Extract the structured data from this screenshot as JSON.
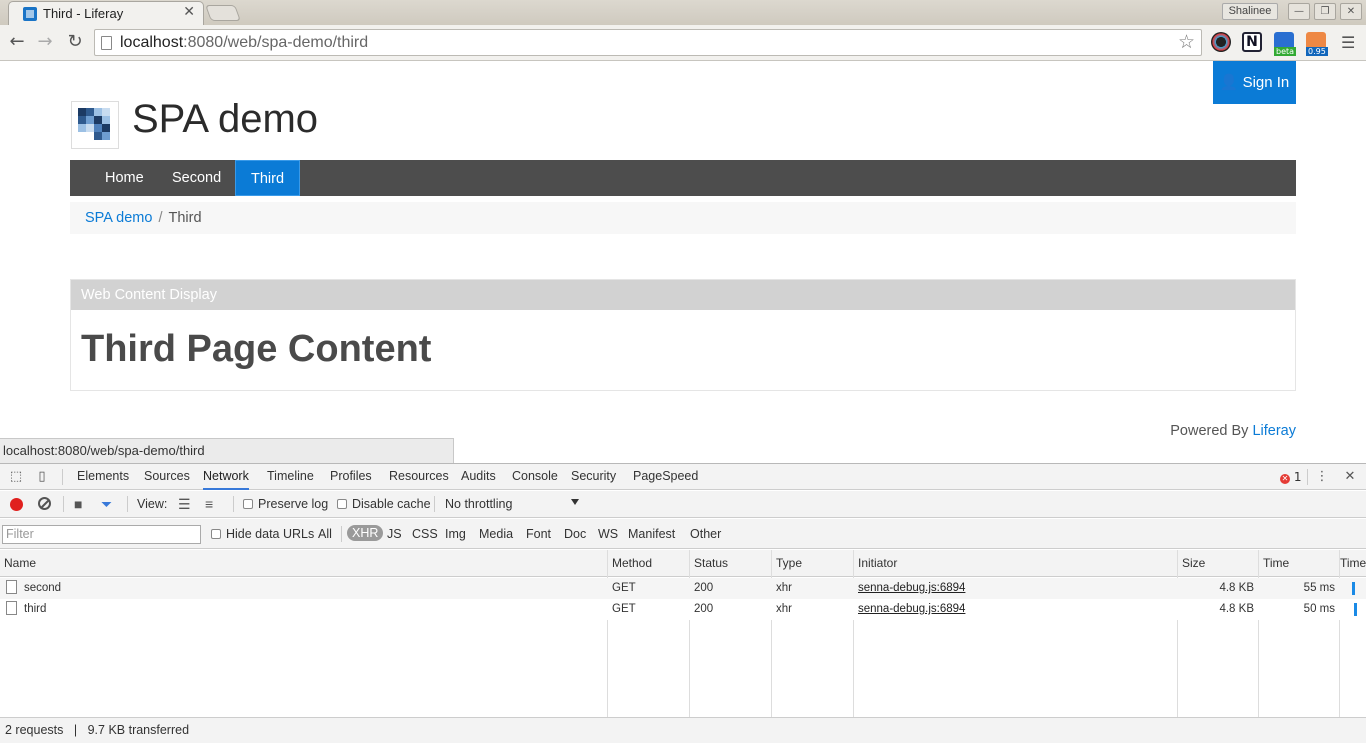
{
  "browser": {
    "tab_title": "Third - Liferay",
    "profile_name": "Shalinee",
    "url_host": "localhost",
    "url_rest": ":8080/web/spa-demo/third",
    "ext_badge_beta": "beta",
    "ext_badge_095": "0.95",
    "status_url": "localhost:8080/web/spa-demo/third"
  },
  "site": {
    "sign_in": "Sign In",
    "name": "SPA demo",
    "nav": [
      "Home",
      "Second",
      "Third"
    ],
    "breadcrumb": [
      "SPA demo",
      "/",
      "Third"
    ],
    "portlet_title": "Web Content Display",
    "content_heading": "Third Page Content",
    "powered_prefix": "Powered By",
    "powered_link": "Liferay"
  },
  "devtools": {
    "tabs": [
      "Elements",
      "Sources",
      "Network",
      "Timeline",
      "Profiles",
      "Resources",
      "Audits",
      "Console",
      "Security",
      "PageSpeed"
    ],
    "active_tab": "Network",
    "error_count": "1",
    "view_label": "View:",
    "preserve_log": "Preserve log",
    "disable_cache": "Disable cache",
    "throttling": "No throttling",
    "filter_placeholder": "Filter",
    "hide_data_urls": "Hide data URLs",
    "filter_types": [
      "All",
      "XHR",
      "JS",
      "CSS",
      "Img",
      "Media",
      "Font",
      "Doc",
      "WS",
      "Manifest",
      "Other"
    ],
    "active_filter": "XHR",
    "columns": [
      "Name",
      "Method",
      "Status",
      "Type",
      "Initiator",
      "Size",
      "Time",
      "Timeline"
    ],
    "rows": [
      {
        "name": "second",
        "method": "GET",
        "status": "200",
        "type": "xhr",
        "initiator": "senna-debug.js:6894",
        "size": "4.8 KB",
        "time": "55 ms"
      },
      {
        "name": "third",
        "method": "GET",
        "status": "200",
        "type": "xhr",
        "initiator": "senna-debug.js:6894",
        "size": "4.8 KB",
        "time": "50 ms"
      }
    ],
    "summary_requests": "2 requests",
    "summary_sep": "|",
    "summary_transferred": "9.7 KB transferred"
  }
}
